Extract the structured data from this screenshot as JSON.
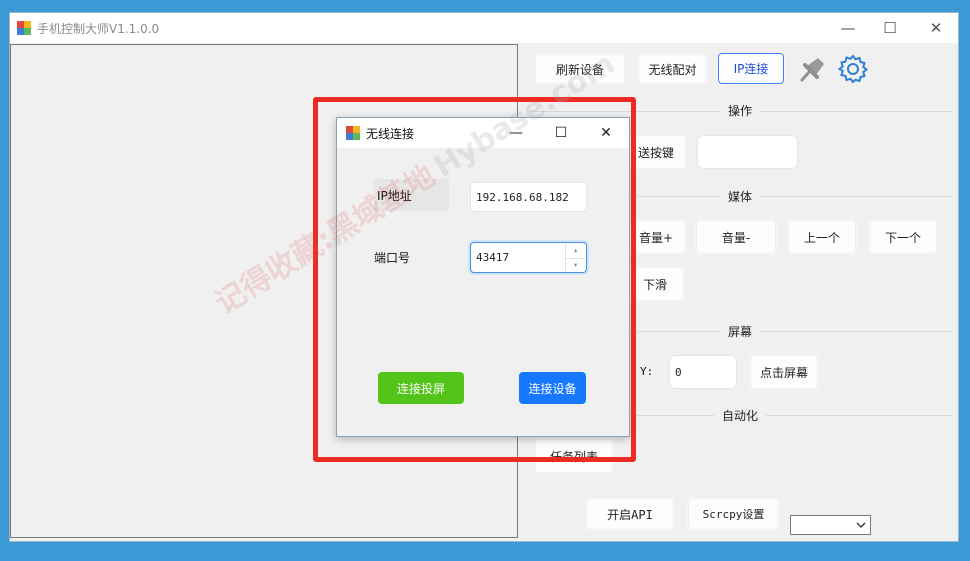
{
  "app": {
    "title": "手机控制大师V1.1.0.0",
    "controls": {
      "minimize": "—",
      "maximize": "☐",
      "close": "✕"
    }
  },
  "toolbar": {
    "refresh_label": "刷新设备",
    "wireless_pair_label": "无线配对",
    "ip_connect_label": "IP连接",
    "pin_icon": "pin-icon",
    "settings_icon": "gear-icon"
  },
  "sections": {
    "operation": "操作",
    "media": "媒体",
    "screen": "屏幕",
    "automation": "自动化"
  },
  "operation": {
    "send_key_label": "送按键",
    "key_value": ""
  },
  "media": {
    "volume_up": "音量+",
    "volume_down": "音量-",
    "prev": "上一个",
    "next": "下一个",
    "swipe_down": "下滑"
  },
  "screen": {
    "y_label": "Y:",
    "y_value": "0",
    "click_label": "点击屏幕"
  },
  "automation": {
    "task_list_label": "任务列表"
  },
  "bottom": {
    "open_api_label": "开启API",
    "scrcpy_label": "Scrcpy设置",
    "select_value": ""
  },
  "dialog": {
    "title": "无线连接",
    "ip_label": "IP地址",
    "ip_value": "192.168.68.182",
    "port_label": "端口号",
    "port_value": "43417",
    "screen_button": "连接投屏",
    "connect_button": "连接设备",
    "controls": {
      "minimize": "—",
      "maximize": "☐",
      "close": "✕"
    }
  },
  "watermark": {
    "text": "记得收藏:黑域基地",
    "site": "Hybase.com"
  },
  "colors": {
    "desktop": "#3b9ad6",
    "window_bg": "#f0f0f0",
    "green_button": "#52c41a",
    "blue_button": "#1677ff",
    "highlight_frame": "#ee2a24",
    "outline_accent": "#3b82f6"
  }
}
